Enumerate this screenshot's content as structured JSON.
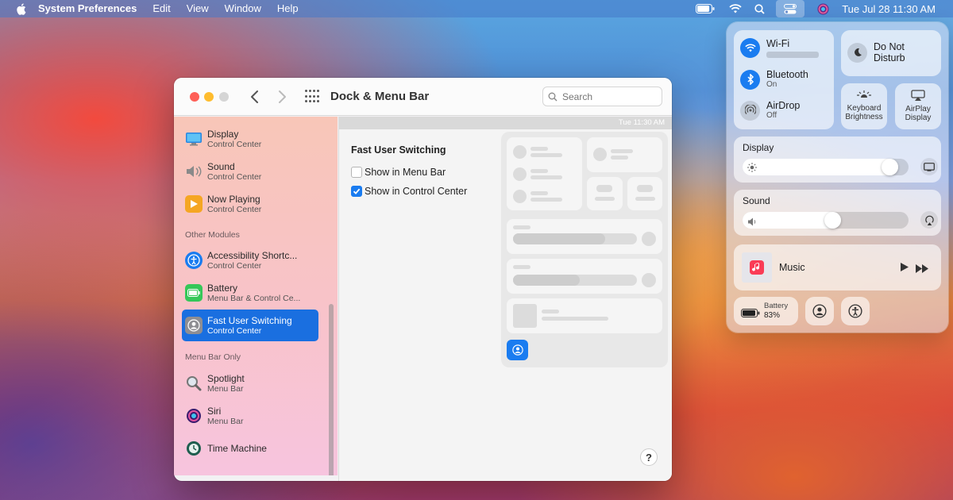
{
  "menubar": {
    "app_name": "System Preferences",
    "items": [
      "Edit",
      "View",
      "Window",
      "Help"
    ],
    "clock": "Tue Jul 28  11:30 AM"
  },
  "window": {
    "title": "Dock & Menu Bar",
    "search_placeholder": "Search"
  },
  "sidebar": {
    "items": [
      {
        "title": "Display",
        "subtitle": "Control Center",
        "icon": "display-icon"
      },
      {
        "title": "Sound",
        "subtitle": "Control Center",
        "icon": "sound-icon"
      },
      {
        "title": "Now Playing",
        "subtitle": "Control Center",
        "icon": "now-playing-icon"
      },
      {
        "title": "Accessibility Shortc...",
        "subtitle": "Control Center",
        "icon": "accessibility-icon"
      },
      {
        "title": "Battery",
        "subtitle": "Menu Bar & Control Ce...",
        "icon": "battery-icon"
      },
      {
        "title": "Fast User Switching",
        "subtitle": "Control Center",
        "icon": "user-icon",
        "selected": true
      },
      {
        "title": "Spotlight",
        "subtitle": "Menu Bar",
        "icon": "spotlight-icon"
      },
      {
        "title": "Siri",
        "subtitle": "Menu Bar",
        "icon": "siri-icon"
      },
      {
        "title": "Time Machine",
        "subtitle": "",
        "icon": "time-machine-icon"
      }
    ],
    "sections": {
      "other": "Other Modules",
      "menu_bar_only": "Menu Bar Only"
    }
  },
  "main": {
    "preview_clock": "Tue 11:30 AM",
    "section_title": "Fast User Switching",
    "options": [
      {
        "label": "Show in Menu Bar",
        "checked": false
      },
      {
        "label": "Show in Control Center",
        "checked": true
      }
    ],
    "help": "?"
  },
  "control_center": {
    "wifi": {
      "title": "Wi-Fi"
    },
    "bluetooth": {
      "title": "Bluetooth",
      "status": "On"
    },
    "airdrop": {
      "title": "AirDrop",
      "status": "Off"
    },
    "dnd": {
      "line1": "Do Not",
      "line2": "Disturb"
    },
    "keyboard": {
      "line1": "Keyboard",
      "line2": "Brightness"
    },
    "airplay": {
      "line1": "AirPlay",
      "line2": "Display"
    },
    "display": {
      "label": "Display",
      "level": 0.93
    },
    "sound": {
      "label": "Sound",
      "level": 0.55
    },
    "music": {
      "label": "Music"
    },
    "battery": {
      "label": "Battery",
      "percent": "83%"
    }
  },
  "colors": {
    "accent": "#1a7cf0",
    "selected": "#1a6fe0"
  }
}
